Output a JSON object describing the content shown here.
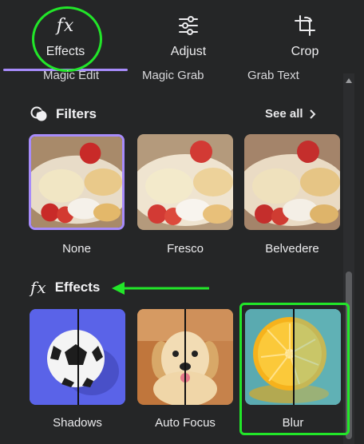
{
  "tabs": [
    {
      "label": "Effects",
      "icon": "fx-icon",
      "active": true
    },
    {
      "label": "Adjust",
      "icon": "sliders-icon",
      "active": false
    },
    {
      "label": "Crop",
      "icon": "crop-icon",
      "active": false
    }
  ],
  "sub_row": [
    "Magic Edit",
    "Magic Grab",
    "Grab Text"
  ],
  "filters": {
    "title": "Filters",
    "see_all": "See all",
    "items": [
      {
        "label": "None",
        "selected": true
      },
      {
        "label": "Fresco",
        "selected": false
      },
      {
        "label": "Belvedere",
        "selected": false
      }
    ]
  },
  "effects": {
    "title": "Effects",
    "items": [
      {
        "label": "Shadows"
      },
      {
        "label": "Auto Focus"
      },
      {
        "label": "Blur"
      }
    ]
  },
  "colors": {
    "panel_bg": "#252627",
    "accent": "#a78bfa",
    "annotation_green": "#22e629"
  }
}
